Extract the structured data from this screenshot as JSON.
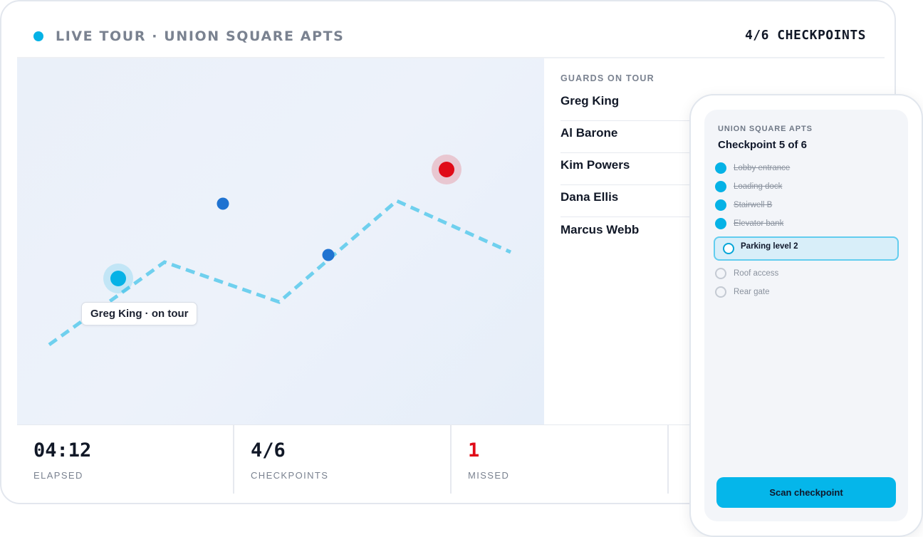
{
  "header": {
    "title": "LIVE TOUR · UNION SQUARE APTS",
    "checkpoint_count": "4/6 CHECKPOINTS",
    "live_color": "#05b2e6"
  },
  "map": {
    "tooltip": "Greg King · on tour",
    "colors": {
      "route": "#6fd0ee",
      "active_guard": "#05b2e6",
      "guard": "#1f73d1",
      "alert": "#e00b18"
    }
  },
  "guards": {
    "heading": "GUARDS ON TOUR",
    "items": [
      {
        "name": "Greg King"
      },
      {
        "name": "Al Barone"
      },
      {
        "name": "Kim Powers"
      },
      {
        "name": "Dana Ellis"
      },
      {
        "name": "Marcus Webb"
      }
    ]
  },
  "stats": [
    {
      "value": "04:12",
      "label": "ELAPSED"
    },
    {
      "value": "4/6",
      "label": "CHECKPOINTS"
    },
    {
      "value": "1",
      "label": "MISSED"
    }
  ],
  "phone": {
    "site": "UNION SQUARE APTS",
    "title": "Checkpoint 5 of 6",
    "checkpoints": [
      {
        "label": "Lobby entrance",
        "status": "done"
      },
      {
        "label": "Loading dock",
        "status": "done"
      },
      {
        "label": "Stairwell B",
        "status": "done"
      },
      {
        "label": "Elevator bank",
        "status": "done"
      },
      {
        "label": "Parking level 2",
        "status": "current"
      },
      {
        "label": "Roof access",
        "status": "pending"
      },
      {
        "label": "Rear gate",
        "status": "pending"
      }
    ],
    "scan_button": "Scan checkpoint"
  }
}
